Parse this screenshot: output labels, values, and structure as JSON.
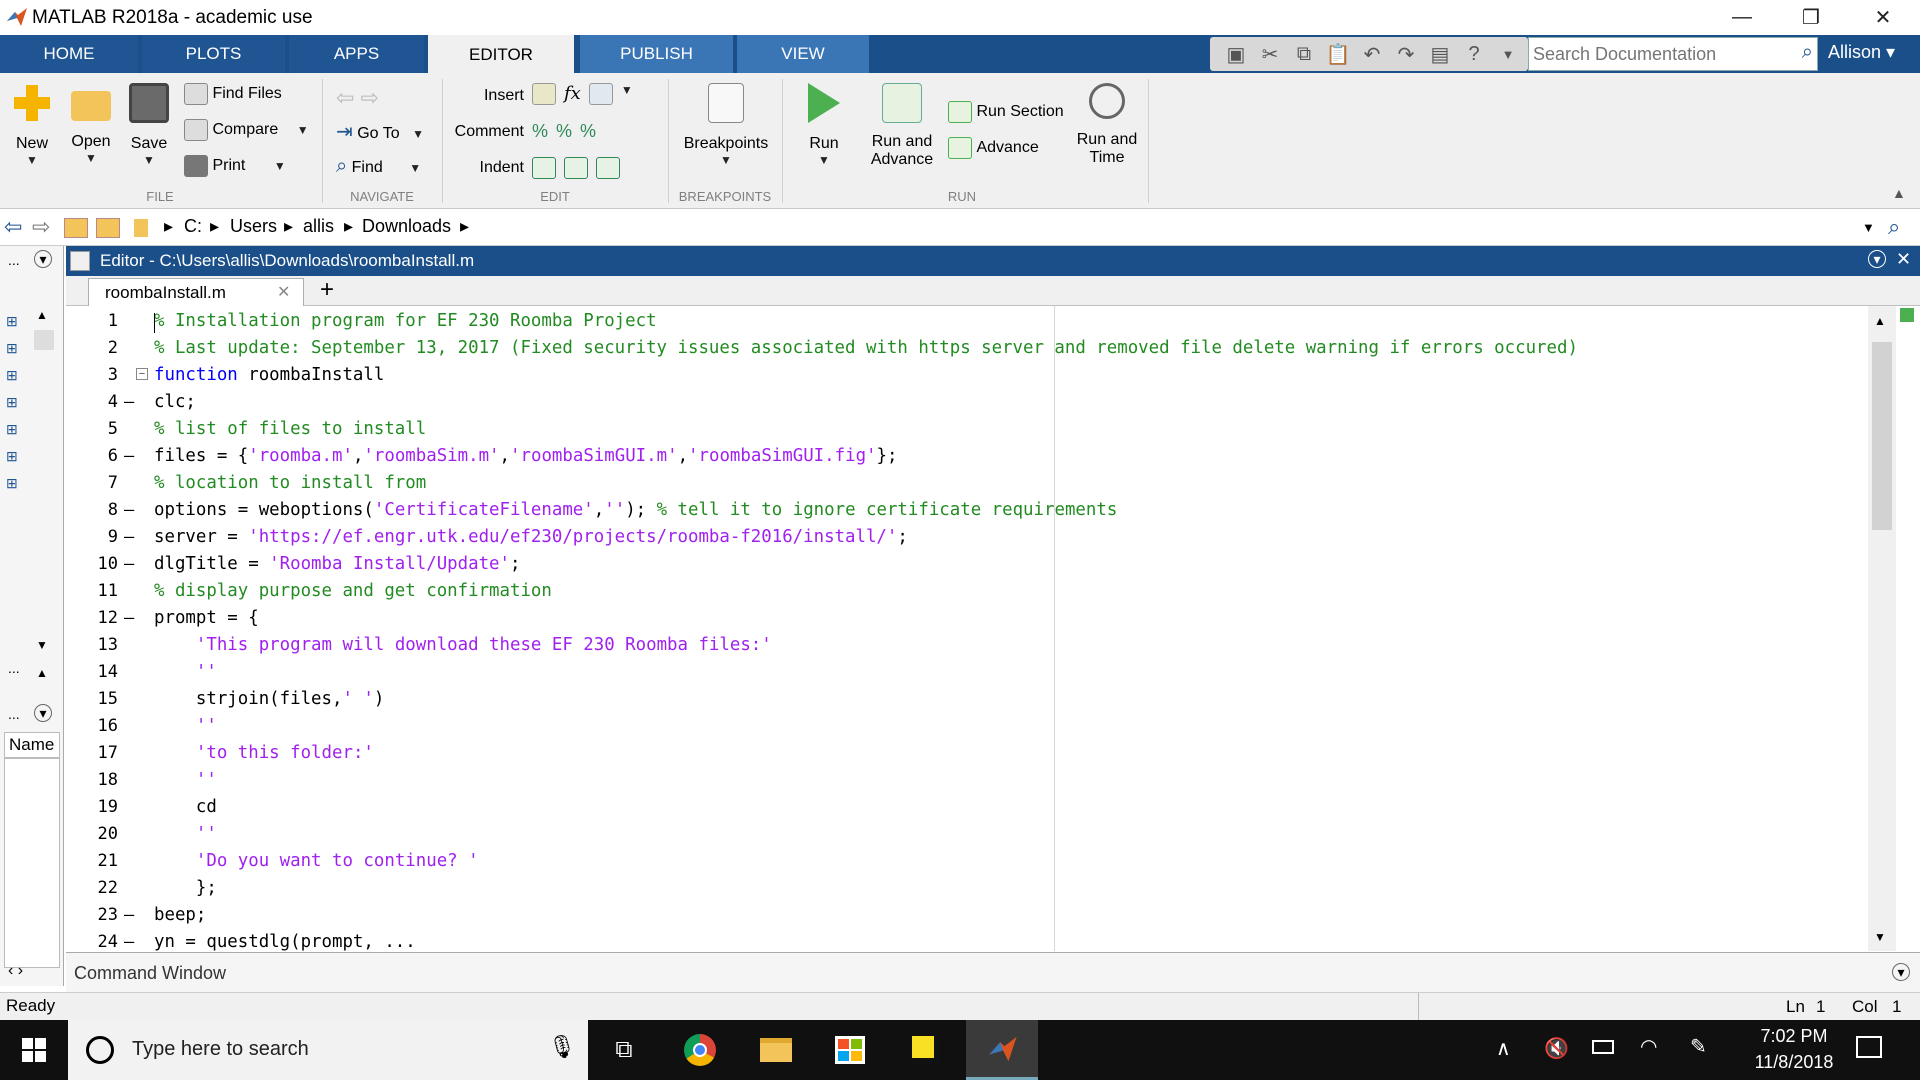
{
  "window": {
    "title": "MATLAB R2018a - academic use",
    "minimize": "—",
    "restore": "❐",
    "close": "✕"
  },
  "tabs": [
    {
      "label": "HOME"
    },
    {
      "label": "PLOTS"
    },
    {
      "label": "APPS"
    },
    {
      "label": "EDITOR"
    },
    {
      "label": "PUBLISH"
    },
    {
      "label": "VIEW"
    }
  ],
  "search": {
    "placeholder": "Search Documentation"
  },
  "user": {
    "name": "Allison ▾"
  },
  "ribbon": {
    "file": {
      "new": "New",
      "open": "Open",
      "save": "Save",
      "find_files": "Find Files",
      "compare": "Compare",
      "print": "Print",
      "group": "FILE"
    },
    "navigate": {
      "go_to": "Go To",
      "find": "Find",
      "group": "NAVIGATE"
    },
    "edit": {
      "insert": "Insert",
      "comment": "Comment",
      "indent": "Indent",
      "group": "EDIT"
    },
    "breakpoints": {
      "label": "Breakpoints",
      "group": "BREAKPOINTS"
    },
    "run": {
      "run": "Run",
      "run_and_advance_1": "Run and",
      "run_and_advance_2": "Advance",
      "run_section": "Run Section",
      "advance": "Advance",
      "run_and_time_1": "Run and",
      "run_and_time_2": "Time",
      "group": "RUN"
    }
  },
  "path": {
    "drive": "C:",
    "parts": [
      "Users",
      "allis",
      "Downloads"
    ]
  },
  "editor": {
    "header": "Editor - C:\\Users\\allis\\Downloads\\roombaInstall.m",
    "file_tab": "roombaInstall.m",
    "lines": [
      {
        "n": "1",
        "dash": false,
        "t": [
          [
            "cm",
            "% Installation program for EF 230 Roomba Project"
          ]
        ]
      },
      {
        "n": "2",
        "dash": false,
        "t": [
          [
            "cm",
            "% Last update: September 13, 2017 (Fixed security issues associated with https server and removed file delete warning if errors occured)"
          ]
        ]
      },
      {
        "n": "3",
        "dash": false,
        "fold": true,
        "t": [
          [
            "kw",
            "function"
          ],
          [
            "",
            " roombaInstall"
          ]
        ]
      },
      {
        "n": "4",
        "dash": true,
        "t": [
          [
            "",
            "clc;"
          ]
        ]
      },
      {
        "n": "5",
        "dash": false,
        "t": [
          [
            "cm",
            "% list of files to install"
          ]
        ]
      },
      {
        "n": "6",
        "dash": true,
        "t": [
          [
            "",
            "files = {"
          ],
          [
            "st",
            "'roomba.m'"
          ],
          [
            "",
            ","
          ],
          [
            "st",
            "'roombaSim.m'"
          ],
          [
            "",
            ","
          ],
          [
            "st",
            "'roombaSimGUI.m'"
          ],
          [
            "",
            ","
          ],
          [
            "st",
            "'roombaSimGUI.fig'"
          ],
          [
            "",
            "};"
          ]
        ]
      },
      {
        "n": "7",
        "dash": false,
        "t": [
          [
            "cm",
            "% location to install from"
          ]
        ]
      },
      {
        "n": "8",
        "dash": true,
        "t": [
          [
            "",
            "options = weboptions("
          ],
          [
            "st",
            "'CertificateFilename'"
          ],
          [
            "",
            ","
          ],
          [
            "st",
            "''"
          ],
          [
            "",
            "); "
          ],
          [
            "cm",
            "% tell it to ignore certificate requirements"
          ]
        ]
      },
      {
        "n": "9",
        "dash": true,
        "t": [
          [
            "",
            "server = "
          ],
          [
            "st",
            "'https://ef.engr.utk.edu/ef230/projects/roomba-f2016/install/'"
          ],
          [
            "",
            ";"
          ]
        ]
      },
      {
        "n": "10",
        "dash": true,
        "t": [
          [
            "",
            "dlgTitle = "
          ],
          [
            "st",
            "'Roomba Install/Update'"
          ],
          [
            "",
            ";"
          ]
        ]
      },
      {
        "n": "11",
        "dash": false,
        "t": [
          [
            "cm",
            "% display purpose and get confirmation"
          ]
        ]
      },
      {
        "n": "12",
        "dash": true,
        "t": [
          [
            "",
            "prompt = {"
          ]
        ]
      },
      {
        "n": "13",
        "dash": false,
        "t": [
          [
            "",
            "    "
          ],
          [
            "st",
            "'This program will download these EF 230 Roomba files:'"
          ]
        ]
      },
      {
        "n": "14",
        "dash": false,
        "t": [
          [
            "",
            "    "
          ],
          [
            "st",
            "''"
          ]
        ]
      },
      {
        "n": "15",
        "dash": false,
        "t": [
          [
            "",
            "    strjoin(files,"
          ],
          [
            "st",
            "' '"
          ],
          [
            "",
            ")"
          ]
        ]
      },
      {
        "n": "16",
        "dash": false,
        "t": [
          [
            "",
            "    "
          ],
          [
            "st",
            "''"
          ]
        ]
      },
      {
        "n": "17",
        "dash": false,
        "t": [
          [
            "",
            "    "
          ],
          [
            "st",
            "'to this folder:'"
          ]
        ]
      },
      {
        "n": "18",
        "dash": false,
        "t": [
          [
            "",
            "    "
          ],
          [
            "st",
            "''"
          ]
        ]
      },
      {
        "n": "19",
        "dash": false,
        "t": [
          [
            "",
            "    cd"
          ]
        ]
      },
      {
        "n": "20",
        "dash": false,
        "t": [
          [
            "",
            "    "
          ],
          [
            "st",
            "''"
          ]
        ]
      },
      {
        "n": "21",
        "dash": false,
        "t": [
          [
            "",
            "    "
          ],
          [
            "st",
            "'Do you want to continue? '"
          ]
        ]
      },
      {
        "n": "22",
        "dash": false,
        "t": [
          [
            "",
            "    };"
          ]
        ]
      },
      {
        "n": "23",
        "dash": true,
        "t": [
          [
            "",
            "beep;"
          ]
        ]
      },
      {
        "n": "24",
        "dash": true,
        "t": [
          [
            "",
            "yn = questdlg(prompt, ..."
          ]
        ]
      }
    ]
  },
  "left_panel": {
    "dots1": "...",
    "dots2": "...",
    "name": "Name"
  },
  "command_window": {
    "label": "Command Window"
  },
  "status": {
    "text": "Ready",
    "ln_label": "Ln",
    "ln": "1",
    "col_label": "Col",
    "col": "1"
  },
  "taskbar": {
    "search_placeholder": "Type here to search",
    "time": "7:02 PM",
    "date": "11/8/2018"
  },
  "colors": {
    "accent": "#1b4f8a",
    "comment": "#228b22",
    "keyword": "#0000ff",
    "string": "#a020f0"
  }
}
